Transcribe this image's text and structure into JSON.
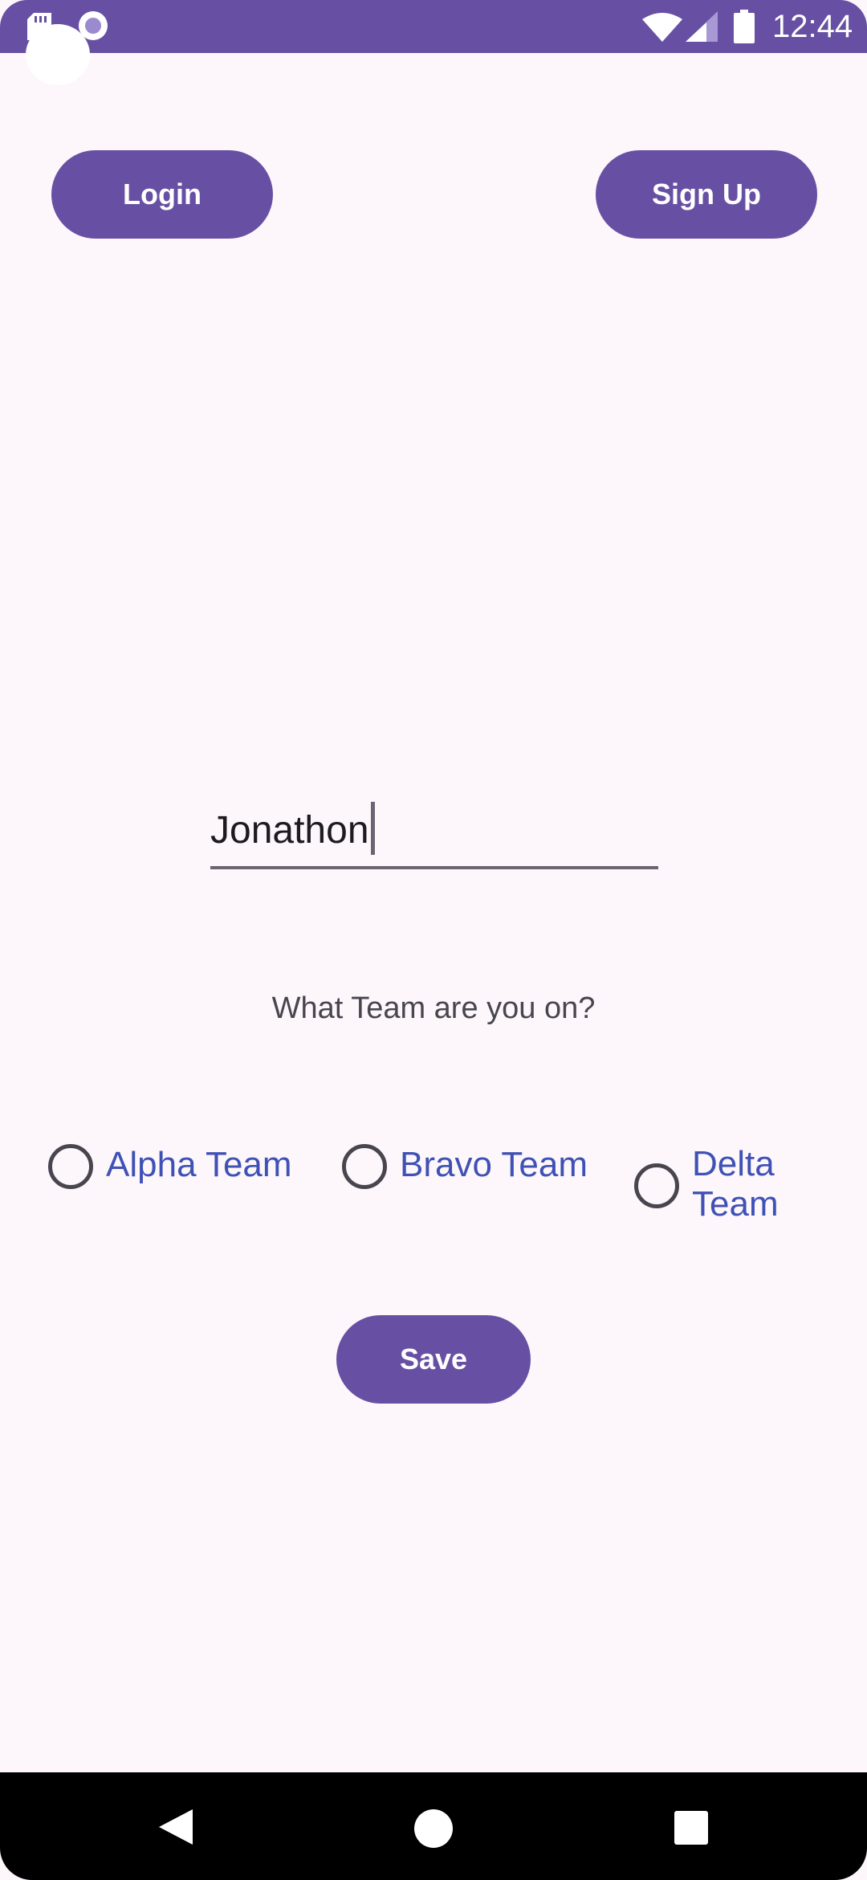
{
  "status_bar": {
    "time": "12:44",
    "icons": [
      "sd-card-icon",
      "record-icon",
      "wifi-icon",
      "signal-icon",
      "battery-icon"
    ]
  },
  "header": {
    "login_label": "Login",
    "signup_label": "Sign Up"
  },
  "form": {
    "name_value": "Jonathon",
    "question": "What Team are you on?",
    "teams": [
      {
        "label": "Alpha Team",
        "checked": false
      },
      {
        "label": "Bravo Team",
        "checked": false
      },
      {
        "label": "Delta Team",
        "checked": false
      }
    ],
    "save_label": "Save"
  },
  "nav_bar": {
    "buttons": [
      "back-icon",
      "home-icon",
      "recents-icon"
    ]
  },
  "colors": {
    "primary": "#6750a4",
    "background": "#fdf7fb",
    "radio_label": "#3f51b5",
    "text": "#1d1b20",
    "secondary_text": "#49454f"
  }
}
